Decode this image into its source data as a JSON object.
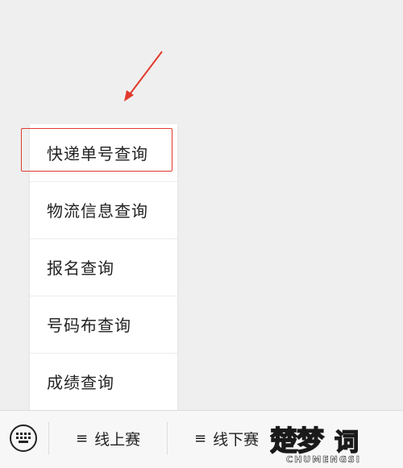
{
  "menu": {
    "items": [
      {
        "label": "快递单号查询",
        "highlighted": true
      },
      {
        "label": "物流信息查询"
      },
      {
        "label": "报名查询"
      },
      {
        "label": "号码布查询"
      },
      {
        "label": "成绩查询"
      }
    ]
  },
  "bottom_bar": {
    "keyboard_icon": "keyboard-icon",
    "tabs": [
      {
        "glyph": "≡",
        "label": "线上赛"
      },
      {
        "glyph": "≡",
        "label": "线下赛"
      }
    ]
  },
  "watermark": {
    "main": "楚梦",
    "second": "词",
    "sub": "CHUMENGSI"
  },
  "colors": {
    "highlight": "#e23a2e",
    "background": "#efefef"
  }
}
